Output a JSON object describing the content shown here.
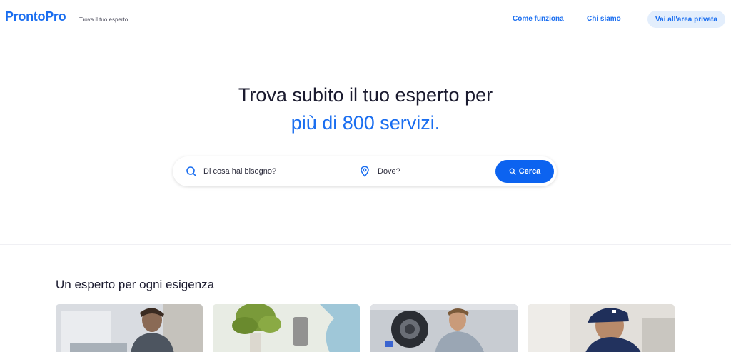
{
  "header": {
    "logo": "ProntoPro",
    "tagline": "Trova il tuo esperto.",
    "nav": [
      {
        "label": "Come funziona"
      },
      {
        "label": "Chi siamo"
      }
    ],
    "private_area_label": "Vai all'area privata"
  },
  "hero": {
    "title": "Trova subito il tuo esperto per",
    "subtitle": "più di 800 servizi."
  },
  "search": {
    "what_placeholder": "Di cosa hai bisogno?",
    "where_placeholder": "Dove?",
    "button_label": "Cerca"
  },
  "section": {
    "title": "Un esperto per ogni esigenza",
    "cards": [
      {
        "image": "man-at-desk-photo"
      },
      {
        "image": "plants-gardening-photo"
      },
      {
        "image": "man-with-dumbbell-photo"
      },
      {
        "image": "technician-cap-photo"
      }
    ]
  },
  "colors": {
    "brand": "#1a6ef0",
    "button": "#0c63f0",
    "private_btn_bg": "#e3eefc"
  }
}
